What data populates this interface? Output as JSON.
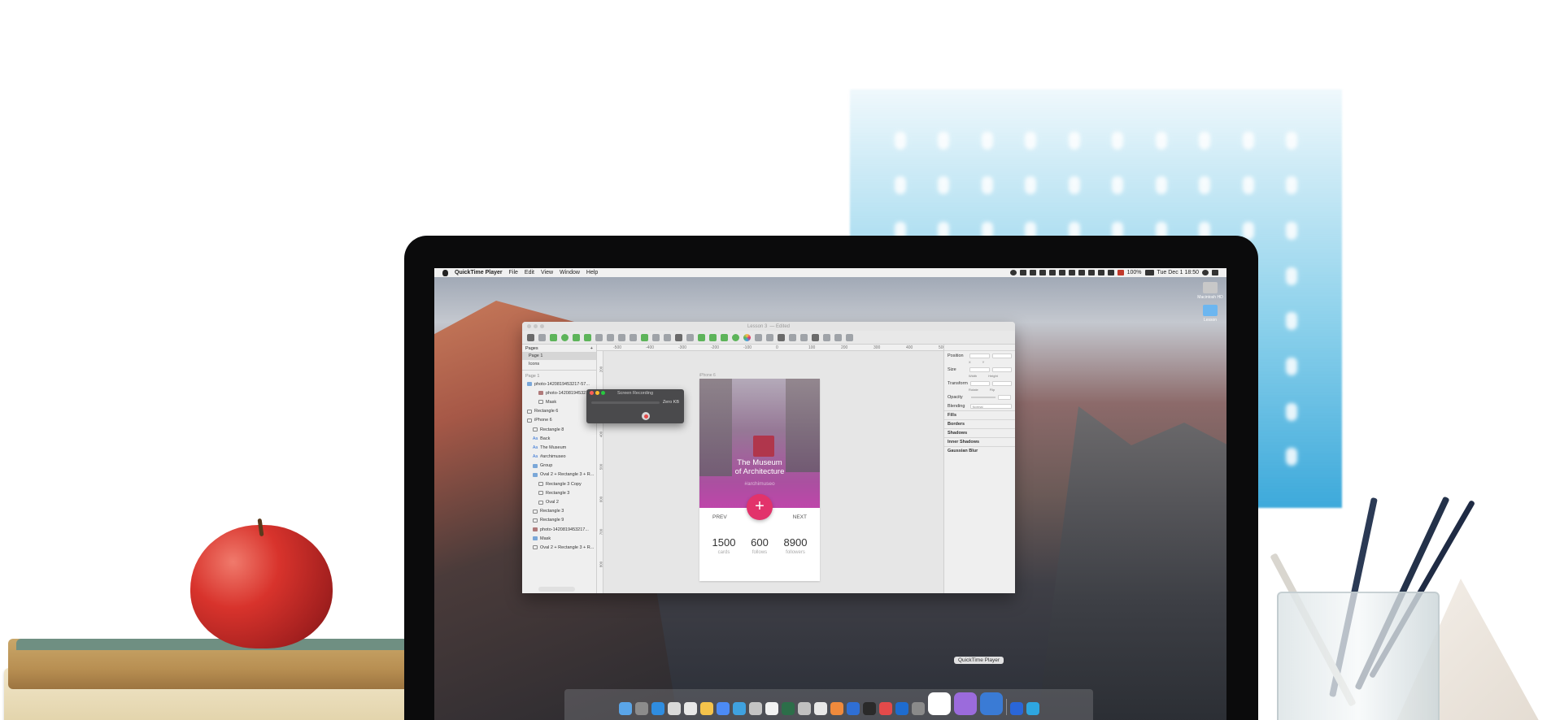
{
  "menubar": {
    "app_name": "QuickTime Player",
    "menus": [
      "File",
      "Edit",
      "View",
      "Window",
      "Help"
    ],
    "battery": "100%",
    "clock": "Tue Dec 1  18:50"
  },
  "desktop": {
    "icon1_label": "Macintosh HD",
    "icon2_label": "Lesson"
  },
  "sketch": {
    "window_title": "Lesson 3",
    "window_subtitle": "— Edited",
    "pages_header": "Pages",
    "pages": [
      "Page 1",
      "Icons"
    ],
    "layers_header": "Page 1",
    "layers": [
      {
        "label": "photo-1420819453217-57...",
        "kind": "folder",
        "indent": 0
      },
      {
        "label": "photo-1420819453217...",
        "kind": "image",
        "indent": 2
      },
      {
        "label": "Mask",
        "kind": "shape",
        "indent": 2
      },
      {
        "label": "Rectangle 6",
        "kind": "shape",
        "indent": 0
      },
      {
        "label": "iPhone 6",
        "kind": "artboard",
        "indent": 0
      },
      {
        "label": "Rectangle 8",
        "kind": "shape",
        "indent": 1
      },
      {
        "label": "Back",
        "kind": "text",
        "indent": 1
      },
      {
        "label": "The Museum",
        "kind": "text",
        "indent": 1
      },
      {
        "label": "#archimuseo",
        "kind": "text",
        "indent": 1
      },
      {
        "label": "Group",
        "kind": "folder",
        "indent": 1
      },
      {
        "label": "Oval 2 + Rectangle 3 + R...",
        "kind": "folder",
        "indent": 1
      },
      {
        "label": "Rectangle 3 Copy",
        "kind": "shape",
        "indent": 2
      },
      {
        "label": "Rectangle 3",
        "kind": "shape",
        "indent": 2
      },
      {
        "label": "Oval 2",
        "kind": "shape",
        "indent": 2
      },
      {
        "label": "Rectangle 3",
        "kind": "shape",
        "indent": 1
      },
      {
        "label": "Rectangle 9",
        "kind": "shape",
        "indent": 1
      },
      {
        "label": "photo-1420819453217...",
        "kind": "image",
        "indent": 1
      },
      {
        "label": "Mask",
        "kind": "folder",
        "indent": 1
      },
      {
        "label": "Oval 2 + Rectangle 3 + R...",
        "kind": "shape",
        "indent": 1
      }
    ],
    "ruler_h": [
      "-500",
      "-400",
      "-300",
      "-200",
      "-100",
      "0",
      "100",
      "200",
      "300",
      "400",
      "500"
    ],
    "ruler_v": [
      "200",
      "300",
      "400",
      "500",
      "600",
      "700",
      "800"
    ],
    "artboard_label": "iPhone 6",
    "app": {
      "title_line1": "The Museum",
      "title_line2": "of Architecture",
      "tag": "#archimuseo",
      "fab": "+",
      "prev": "PREV",
      "next": "NEXT",
      "stats": [
        {
          "value": "1500",
          "label": "cards"
        },
        {
          "value": "600",
          "label": "follows"
        },
        {
          "value": "8900",
          "label": "followers"
        }
      ]
    },
    "inspector": {
      "position": "Position",
      "size": "Size",
      "transform": "Transform",
      "opacity": "Opacity",
      "blending": "Blending",
      "blending_value": "Normal",
      "fills": "Fills",
      "borders": "Borders",
      "shadows": "Shadows",
      "inner_shadows": "Inner Shadows",
      "gaussian_blur": "Gaussian Blur",
      "sub_xy": [
        "X",
        "Y"
      ],
      "sub_wh": [
        "Width",
        "Height"
      ],
      "sub_rot": [
        "Rotate",
        "Flip"
      ]
    }
  },
  "recording": {
    "title": "Screen Recording",
    "size": "Zero KB"
  },
  "dock": {
    "tooltip": "QuickTime Player"
  },
  "colors": {
    "accent_pink": "#e2336b",
    "sketch_green": "#5db45a",
    "traffic_red": "#ff5f57",
    "traffic_yellow": "#ffbd2e",
    "traffic_green": "#28c840"
  }
}
